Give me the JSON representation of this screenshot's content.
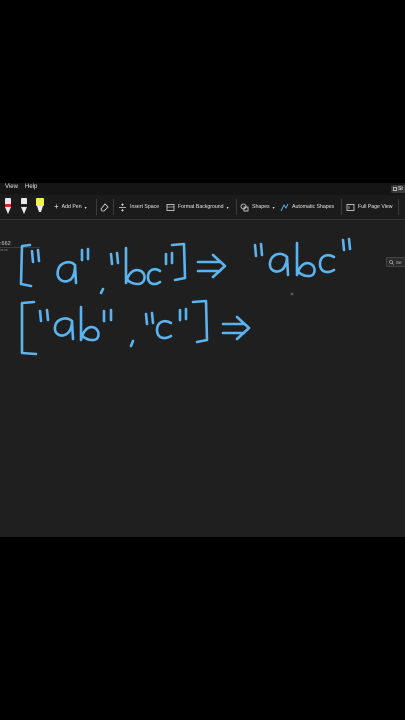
{
  "menubar": {
    "items": [
      "View",
      "Help"
    ],
    "share_label": "St"
  },
  "ribbon": {
    "add_pen": "Add Pen",
    "insert_space": "Insert Space",
    "format_background": "Format Background",
    "shapes": "Shapes",
    "automatic_shapes": "Automatic Shapes",
    "full_page_view": "Full Page View",
    "pen_colors": [
      "#1a1a1a",
      "#1a1a1a",
      "#f3ef5a"
    ]
  },
  "sidebar": {
    "page_label": ":662",
    "page_sub": "45:08"
  },
  "search": {
    "label": "Se"
  },
  "ink_color": "#5bb4ef"
}
